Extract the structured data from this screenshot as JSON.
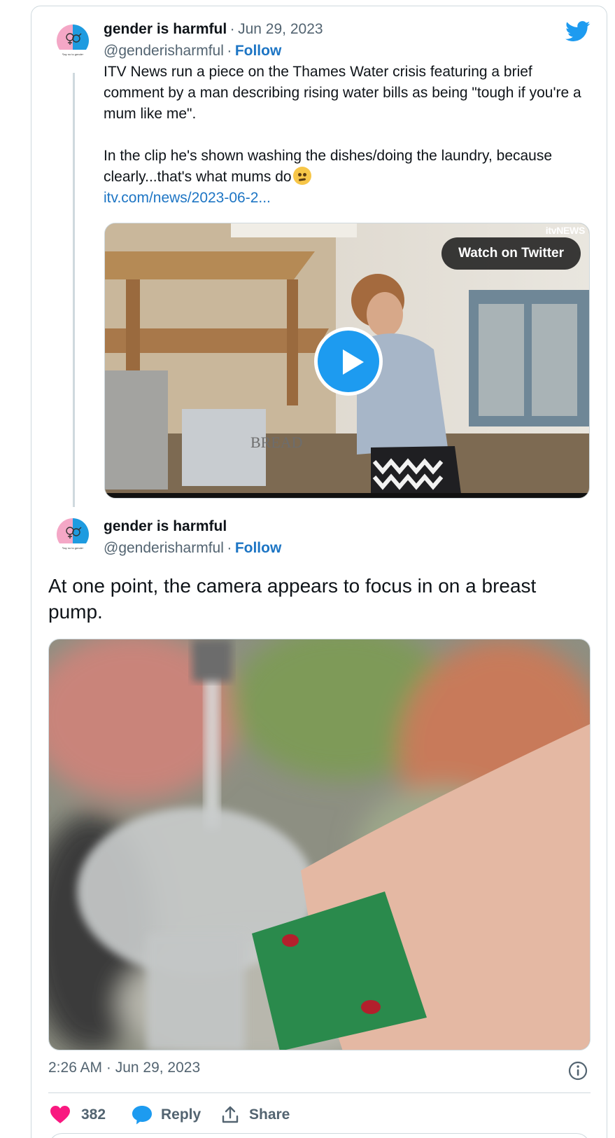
{
  "colors": {
    "link": "#1d75c4",
    "muted": "#536471",
    "twitter_blue": "#1d9bf0",
    "like_pink": "#f91880",
    "border": "#cfd9de"
  },
  "tweet1": {
    "display_name": "gender is harmful",
    "separator": "·",
    "date": "Jun 29, 2023",
    "handle": "@genderisharmful",
    "follow_label": "Follow",
    "avatar_caption": "Say no to gender",
    "text_p1": "ITV News run a piece on the Thames Water crisis featuring a brief comment by a man describing rising water bills as being \"tough if you're a mum like me\".",
    "text_p2": "In the clip he's shown washing the dishes/doing the laundry, because clearly...that's what mums do",
    "emoji": "face-with-rolling-eyes-emoji",
    "link": "itv.com/news/2023-06-2...",
    "video": {
      "watch_label": "Watch on Twitter",
      "broadcaster_logo": "itvNEWS",
      "overlay_text": "BREAD",
      "play_icon": "play-icon"
    }
  },
  "tweet2": {
    "display_name": "gender is harmful",
    "handle": "@genderisharmful",
    "separator": "·",
    "follow_label": "Follow",
    "avatar_caption": "Say no to gender",
    "text": "At one point, the camera appears to focus in on a breast pump.",
    "timestamp": "2:26 AM · Jun 29, 2023",
    "likes": "382",
    "reply_label": "Reply",
    "share_label": "Share"
  }
}
